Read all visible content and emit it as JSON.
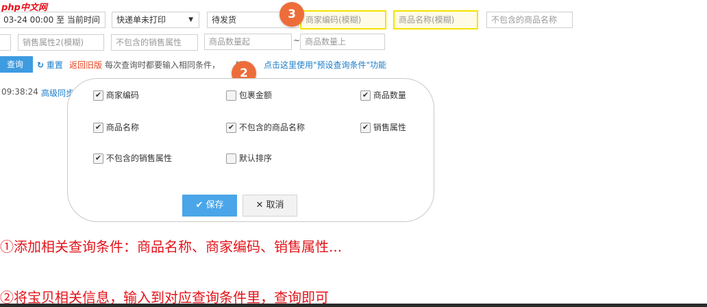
{
  "logo": {
    "php": "php",
    "name": "中文网"
  },
  "filters": {
    "date_range": "03-24 00:00 至 当前时间",
    "print_status": "快递单未打印",
    "order_status": "待发货",
    "merchant_code_ph": "商家编码(模糊)",
    "product_name_ph": "商品名称(模糊)",
    "excluded_product_name_ph": "不包含的商品名称",
    "sales_attr2_ph": "销售属性2(模糊)",
    "excluded_sales_attr_ph": "不包含的销售属性",
    "qty_from_ph": "商品数量起",
    "qty_sep": "~",
    "qty_to_ph": "商品数量上"
  },
  "actions": {
    "query": "查询",
    "reset": "重置",
    "old_version": "返回旧版",
    "tip_pre": "每次查询时都要输入相同条件，",
    "tip_mid": "矩",
    "tip_link": "点击这里使用\"预设查询条件\"功能"
  },
  "sync": {
    "time": "09:38:24",
    "label": "高级同步"
  },
  "badges": {
    "b2": "2",
    "b3": "3"
  },
  "options": [
    {
      "label": "商家编码",
      "checked": true
    },
    {
      "label": "包裹金额",
      "checked": false
    },
    {
      "label": "商品数量",
      "checked": true
    },
    {
      "label": "商品名称",
      "checked": true
    },
    {
      "label": "不包含的商品名称",
      "checked": true
    },
    {
      "label": "销售属性",
      "checked": true
    },
    {
      "label": "不包含的销售属性",
      "checked": true
    },
    {
      "label": "默认排序",
      "checked": false
    }
  ],
  "buttons": {
    "save": "保存",
    "cancel": "取消"
  },
  "notes": {
    "n1": "①添加相关查询条件：商品名称、商家编码、销售属性...",
    "n2": "②将宝贝相关信息，输入到对应查询条件里，查询即可"
  },
  "colors": {
    "badge": "#ed6d3a",
    "highlight": "#f5e200",
    "note": "#e3141b",
    "button": "#4aa6e8"
  }
}
